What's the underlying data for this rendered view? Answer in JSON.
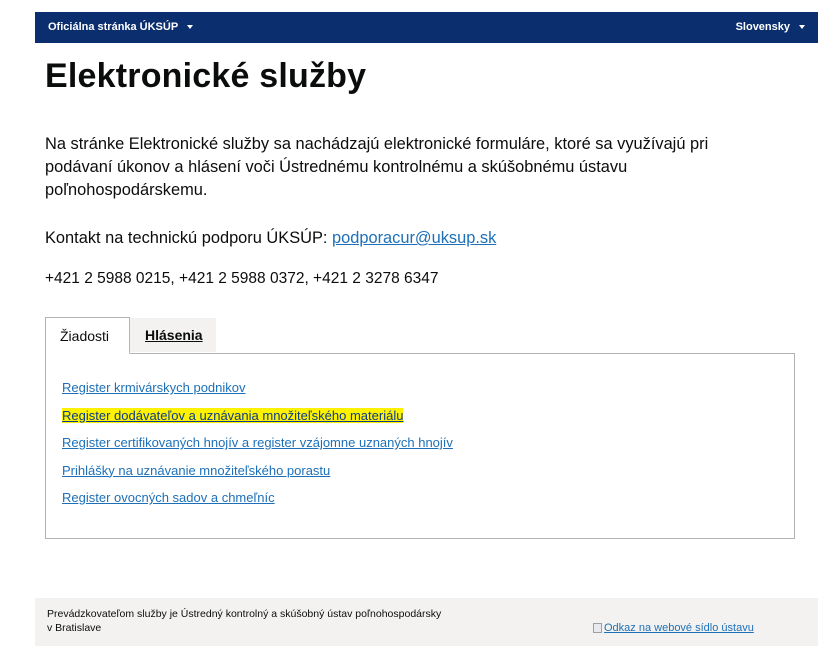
{
  "header": {
    "official_prefix": "Oficiálna stránka",
    "official_org": "ÚKSÚP",
    "language": "Slovensky"
  },
  "page_title": "Elektronické služby",
  "intro": "Na stránke Elektronické služby sa nachádzajú elektronické formuláre, ktoré sa využívajú pri podávaní úkonov a hlásení voči Ústrednému kontrolnému a skúšobnému ústavu poľnohospodárskemu.",
  "contact": {
    "label": "Kontakt na technickú podporu ÚKSÚP:",
    "email": "podporacur@uksup.sk"
  },
  "phones": "+421 2 5988 0215, +421 2 5988 0372, +421 2 3278 6347",
  "tabs": [
    {
      "label": "Žiadosti",
      "active": true
    },
    {
      "label": "Hlásenia",
      "active": false
    }
  ],
  "links": [
    {
      "label": "Register krmivárskych podnikov",
      "highlighted": false
    },
    {
      "label": "Register dodávateľov a uznávania množiteľského materiálu",
      "highlighted": true
    },
    {
      "label": "Register certifikovaných hnojív a register vzájomne uznaných hnojív",
      "highlighted": false
    },
    {
      "label": "Prihlášky na uznávanie množiteľského porastu",
      "highlighted": false
    },
    {
      "label": "Register ovocných sadov a chmeľníc",
      "highlighted": false
    }
  ],
  "footer": {
    "provider": "Prevádzkovateľom služby je Ústredný kontrolný a skúšobný ústav poľnohospodársky v Bratislave",
    "seat_link": "Odkaz na webové sídlo ústavu"
  },
  "colors": {
    "topbar": "#0b2f6e",
    "link": "#1d70b8",
    "highlight": "#fff200",
    "footer_bg": "#f3f2f1"
  }
}
